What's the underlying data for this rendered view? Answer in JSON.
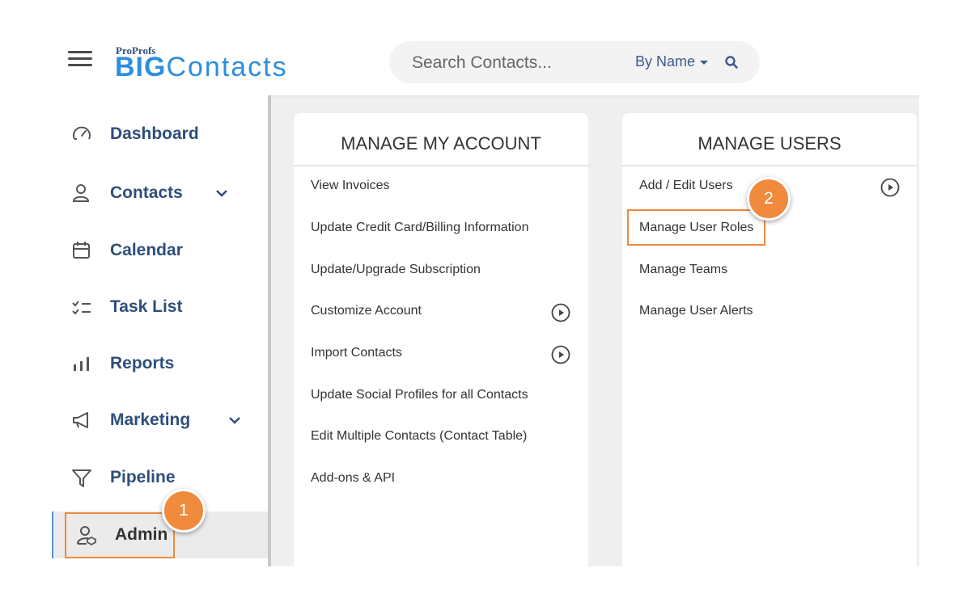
{
  "header": {
    "logo_top": "ProProfs",
    "logo_big": "BIG",
    "logo_contacts": "Contacts",
    "search_placeholder": "Search Contacts...",
    "search_mode": "By Name"
  },
  "sidebar": {
    "items": [
      {
        "label": "Dashboard",
        "icon": "dashboard-gauge-icon"
      },
      {
        "label": "Contacts",
        "icon": "user-icon",
        "has_dropdown": true
      },
      {
        "label": "Calendar",
        "icon": "calendar-icon"
      },
      {
        "label": "Task List",
        "icon": "task-list-icon"
      },
      {
        "label": "Reports",
        "icon": "bar-chart-icon"
      },
      {
        "label": "Marketing",
        "icon": "megaphone-icon",
        "has_dropdown": true
      },
      {
        "label": "Pipeline",
        "icon": "funnel-icon"
      },
      {
        "label": "Admin",
        "icon": "admin-user-icon",
        "active": true
      }
    ]
  },
  "badges": {
    "step1": "1",
    "step2": "2"
  },
  "manage_account": {
    "title": "MANAGE MY ACCOUNT",
    "items": [
      {
        "label": "View Invoices"
      },
      {
        "label": "Update Credit Card/Billing Information"
      },
      {
        "label": "Update/Upgrade Subscription"
      },
      {
        "label": "Customize Account",
        "has_video": true
      },
      {
        "label": "Import Contacts",
        "has_video": true
      },
      {
        "label": "Update Social Profiles for all Contacts"
      },
      {
        "label": "Edit Multiple Contacts (Contact Table)"
      },
      {
        "label": "Add-ons & API"
      }
    ]
  },
  "manage_users": {
    "title": "MANAGE USERS",
    "items": [
      {
        "label": "Add / Edit Users",
        "has_video": true
      },
      {
        "label": "Manage User Roles",
        "highlighted": true
      },
      {
        "label": "Manage Teams"
      },
      {
        "label": "Manage User Alerts"
      }
    ]
  },
  "colors": {
    "accent_orange": "#f08a3c",
    "nav_blue": "#2f4f7a",
    "logo_blue": "#2d8ee0"
  }
}
